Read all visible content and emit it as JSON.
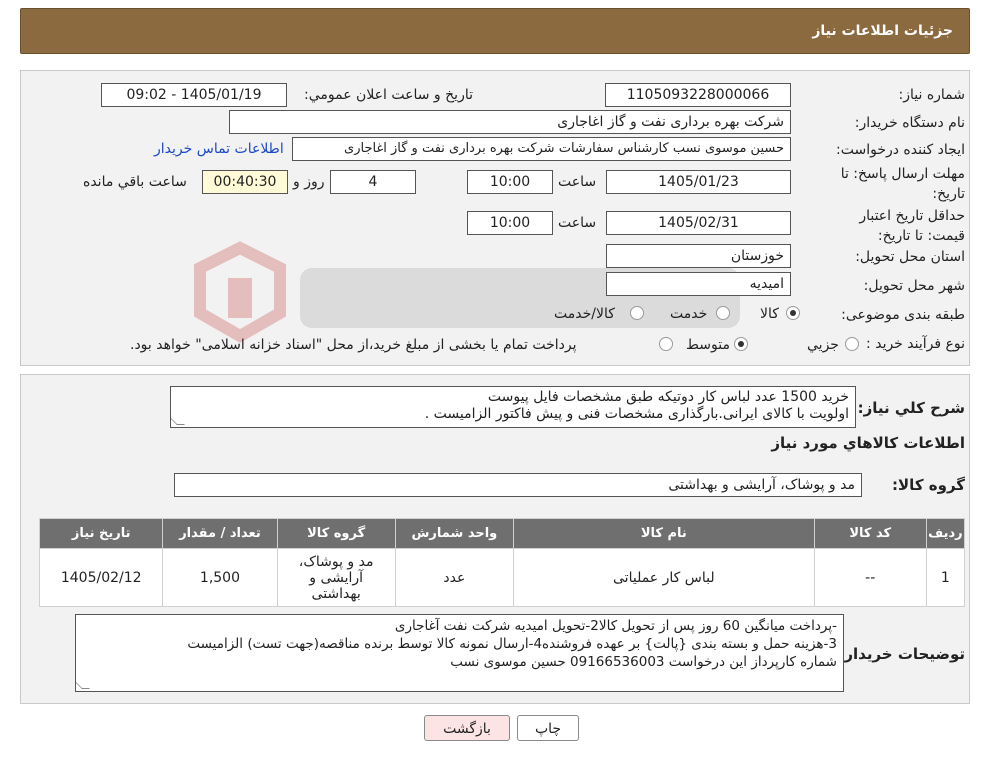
{
  "header": {
    "title": "جزئیات اطلاعات نیاز"
  },
  "form": {
    "need_number_label": "شماره نیاز:",
    "need_number": "1105093228000066",
    "announce_label": "تاریخ و ساعت اعلان عمومي:",
    "announce_value": "1405/01/19 - 09:02",
    "buyer_label": "نام دستگاه خریدار:",
    "buyer_value": "شرکت بهره برداری نفت و گاز اغاجاری",
    "creator_label": "ایجاد کننده درخواست:",
    "creator_value": "حسین موسوی نسب کارشناس سفارشات شرکت بهره برداری نفت و گاز اغاجاری",
    "contact_link": "اطلاعات تماس خریدار",
    "deadline_label": "مهلت ارسال پاسخ: تا تاریخ:",
    "deadline_date": "1405/01/23",
    "time_label": "ساعت",
    "deadline_time": "10:00",
    "days_value": "4",
    "days_label": "روز و",
    "remaining_value": "00:40:30",
    "remaining_label": "ساعت باقي مانده",
    "validity_label": "حداقل تاریخ اعتبار قیمت: تا تاریخ:",
    "validity_date": "1405/02/31",
    "validity_time": "10:00",
    "province_label": "استان محل تحویل:",
    "province_value": "خوزستان",
    "city_label": "شهر محل تحویل:",
    "city_value": "امیدیه",
    "category_label": "طبقه بندی موضوعی:",
    "category_options": [
      "کالا",
      "خدمت",
      "کالا/خدمت"
    ],
    "process_label": "نوع فرآیند خرید :",
    "process_options": [
      "جزیي",
      "متوسط"
    ],
    "process_note": "پرداخت تمام یا بخشی از مبلغ خرید،از محل \"اسناد خزانه اسلامی\" خواهد بود."
  },
  "description": {
    "label": "شرح کلي نياز:",
    "line1": "خرید  1500 عدد لباس کار دوتیکه   طبق  مشخصات فایل پیوست",
    "line2": "اولویت با کالای ایرانی.بارگذاری مشخصات فنی و پیش فاکتور الزامیست ."
  },
  "items_section": {
    "title": "اطلاعات کالاهاي مورد نياز",
    "group_label": "گروه کالا:",
    "group_value": "مد و پوشاک، آرایشی و بهداشتی",
    "columns": [
      "رديف",
      "کد کالا",
      "نام کالا",
      "واحد شمارش",
      "گروه کالا",
      "تعداد / مقدار",
      "تاریخ نیاز"
    ],
    "rows": [
      {
        "row": "1",
        "code": "--",
        "name": "لباس کار عملیاتی",
        "unit": "عدد",
        "group_l1": "مد و پوشاک،",
        "group_l2": "آرایشی و",
        "group_l3": "بهداشتی",
        "qty": "1,500",
        "date": "1405/02/12"
      }
    ]
  },
  "buyer_notes": {
    "label": "توضیحات خریدار:",
    "line1": "-پرداخت میانگین 60 روز پس از تحویل کالا2-تحویل امیدیه شرکت نفت آغاجاری",
    "line2": "3-هزینه حمل  و بسته بندی {پالت} بر عهده فروشنده4-ارسال نمونه کالا توسط برنده مناقصه(جهت تست) الزامیست",
    "line3": "شماره کارپرداز این درخواست 09166536003 حسین موسوی نسب"
  },
  "buttons": {
    "print": "چاپ",
    "back": "بازگشت"
  },
  "colors": {
    "header_bg": "#8b6a3f",
    "table_header_bg": "#6f6f6f",
    "back_btn_bg": "#fde4e4",
    "link": "#1a48c8"
  }
}
